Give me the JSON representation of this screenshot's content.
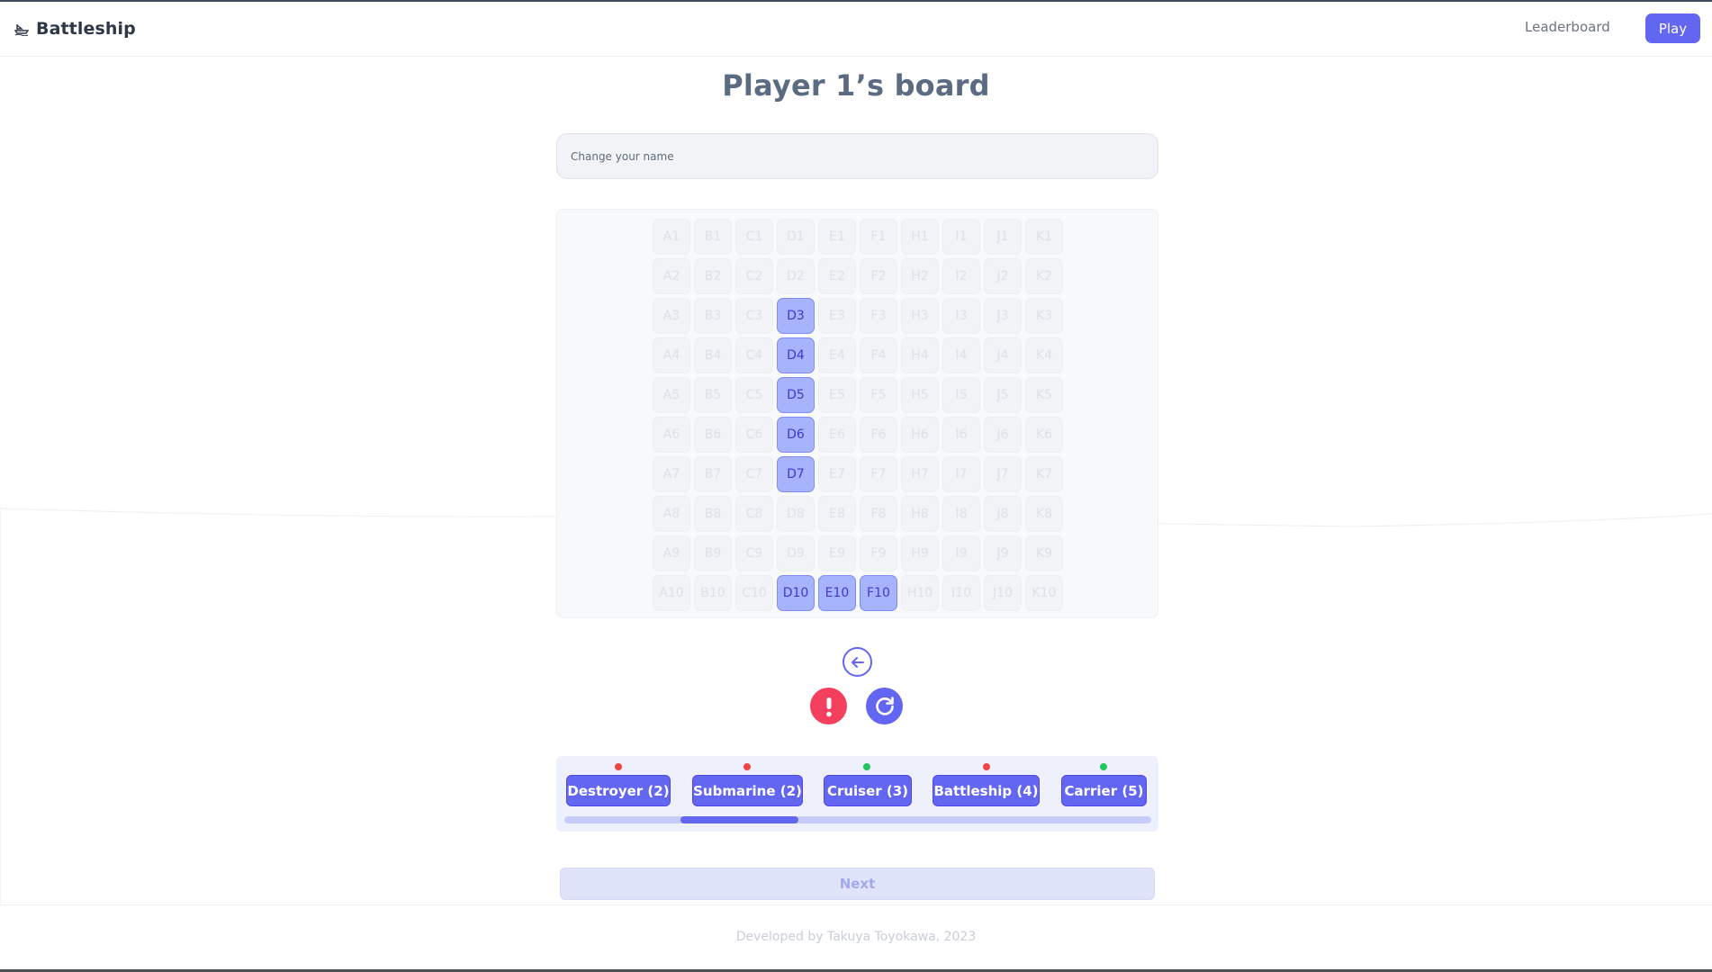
{
  "header": {
    "app_title": "Battleship",
    "nav_leaderboard": "Leaderboard",
    "nav_play": "Play"
  },
  "board": {
    "title": "Player 1’s board",
    "name_placeholder": "Change your name",
    "columns": [
      "A",
      "B",
      "C",
      "D",
      "E",
      "F",
      "H",
      "I",
      "J",
      "K"
    ],
    "rows": [
      "1",
      "2",
      "3",
      "4",
      "5",
      "6",
      "7",
      "8",
      "9",
      "10"
    ],
    "placed_cells": [
      "D3",
      "D4",
      "D5",
      "D6",
      "D7",
      "D10",
      "E10",
      "F10"
    ]
  },
  "ships": [
    {
      "label": "Destroyer (2)",
      "placed": false
    },
    {
      "label": "Submarine (2)",
      "placed": false
    },
    {
      "label": "Cruiser (3)",
      "placed": true
    },
    {
      "label": "Battleship (4)",
      "placed": false
    },
    {
      "label": "Carrier (5)",
      "placed": true
    }
  ],
  "ships_scroll_position": 0.2,
  "next_label": "Next",
  "footer_text": "Developed by Takuya Toyokawa, 2023",
  "colors": {
    "accent": "#6366f1",
    "danger": "#f43f5e",
    "status_unplaced": "#ef4444",
    "status_placed": "#22c55e",
    "cell_filled": "#a5b4fc"
  }
}
